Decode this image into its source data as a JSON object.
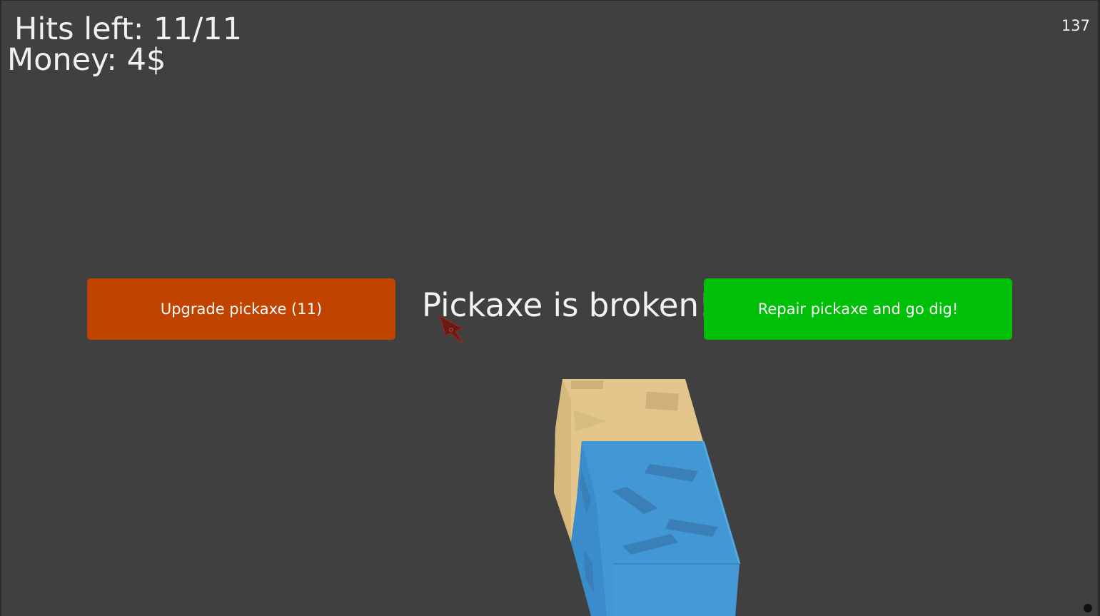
{
  "hud": {
    "hits_left": "Hits left: 11/11",
    "money": "Money: 4$",
    "fps": "137"
  },
  "dialog": {
    "message": "Pickaxe is broken!",
    "upgrade_label": "Upgrade pickaxe (11)",
    "repair_label": "Repair pickaxe and go dig!"
  },
  "colors": {
    "background": "#404040",
    "upgrade_button": "#c04300",
    "repair_button": "#00bf08",
    "sand_block": "#e2c68b",
    "water_block": "#4298d4"
  },
  "icons": {
    "cursor": "arrow-cursor-icon"
  }
}
